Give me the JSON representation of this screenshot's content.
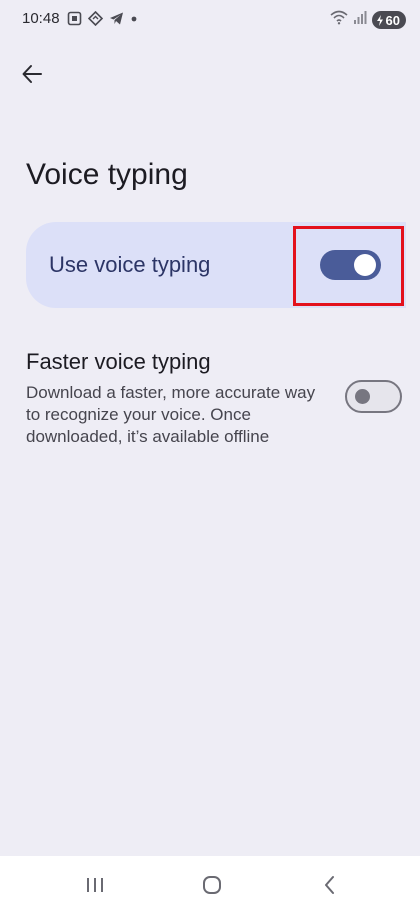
{
  "status_bar": {
    "time": "10:48",
    "battery_level": "60",
    "left_icons": [
      "screenshot-icon",
      "nav-diamond-icon",
      "telegram-icon",
      "dot-icon"
    ],
    "right_icons": [
      "wifi-icon",
      "signal-icon",
      "battery-icon"
    ]
  },
  "header": {
    "back_icon": "arrow-left-icon"
  },
  "page": {
    "title": "Voice typing"
  },
  "main_toggle": {
    "label": "Use voice typing",
    "enabled": true,
    "accent_color": "#4a5c99",
    "highlight_color": "#e3111c"
  },
  "faster_voice": {
    "title": "Faster voice typing",
    "description": "Download a faster, more accurate way to recognize your voice. Once downloaded, it’s available offline",
    "enabled": false
  },
  "nav_bar": {
    "items": [
      "recents-icon",
      "home-icon",
      "back-icon"
    ]
  }
}
